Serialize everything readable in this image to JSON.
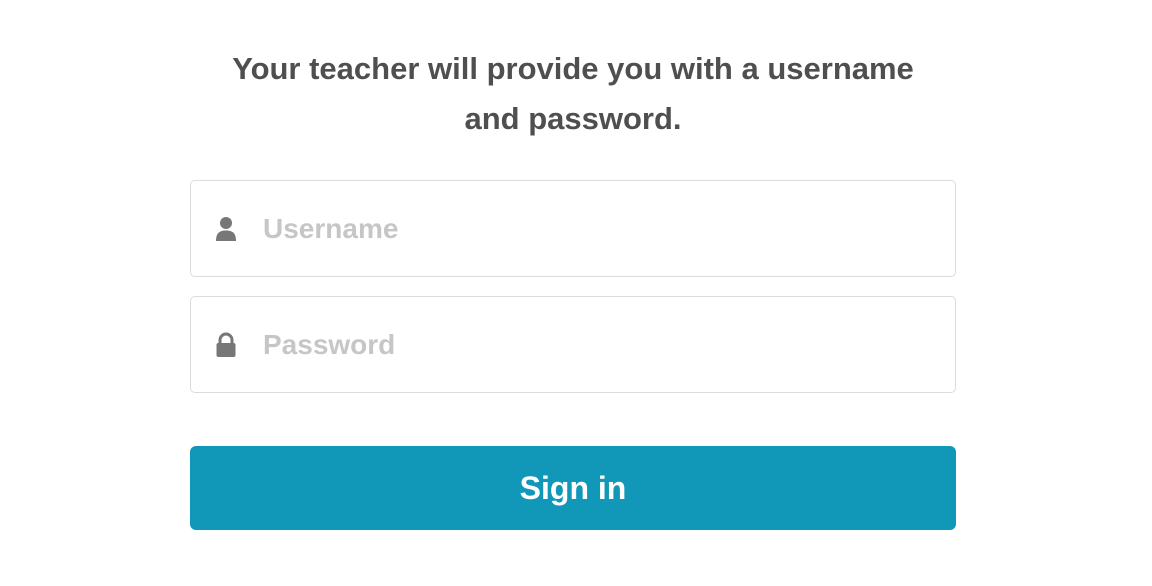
{
  "instructions": {
    "line1": "Your teacher will provide you with a username",
    "line2": "and password."
  },
  "username": {
    "icon": "user-icon",
    "placeholder": "Username",
    "value": ""
  },
  "password": {
    "icon": "lock-icon",
    "placeholder": "Password",
    "value": ""
  },
  "signin": {
    "label": "Sign in",
    "color": "#1198b9"
  },
  "colors": {
    "text": "#4f4f4f",
    "placeholder": "#c6c6c6",
    "border": "#dcdcdc",
    "icon": "#777777"
  }
}
